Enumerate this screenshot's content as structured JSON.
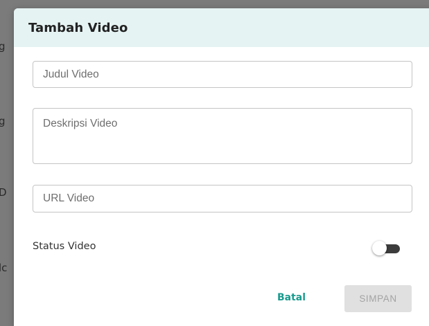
{
  "dialog": {
    "title": "Tambah Video",
    "fields": {
      "title_placeholder": "Judul Video",
      "description_placeholder": "Deskripsi Video",
      "url_placeholder": "URL Video"
    },
    "status": {
      "label": "Status Video",
      "enabled": false
    },
    "actions": {
      "cancel_label": "Batal",
      "save_label": "SIMPAN",
      "save_disabled": true
    }
  },
  "colors": {
    "header_bg": "#e6f3f3",
    "accent": "#1a9b8e",
    "toggle_track": "#3c3c3c",
    "disabled_button_bg": "#e0e0e0",
    "disabled_button_text": "#a3a3a3",
    "overlay": "#7b7b7b"
  }
}
